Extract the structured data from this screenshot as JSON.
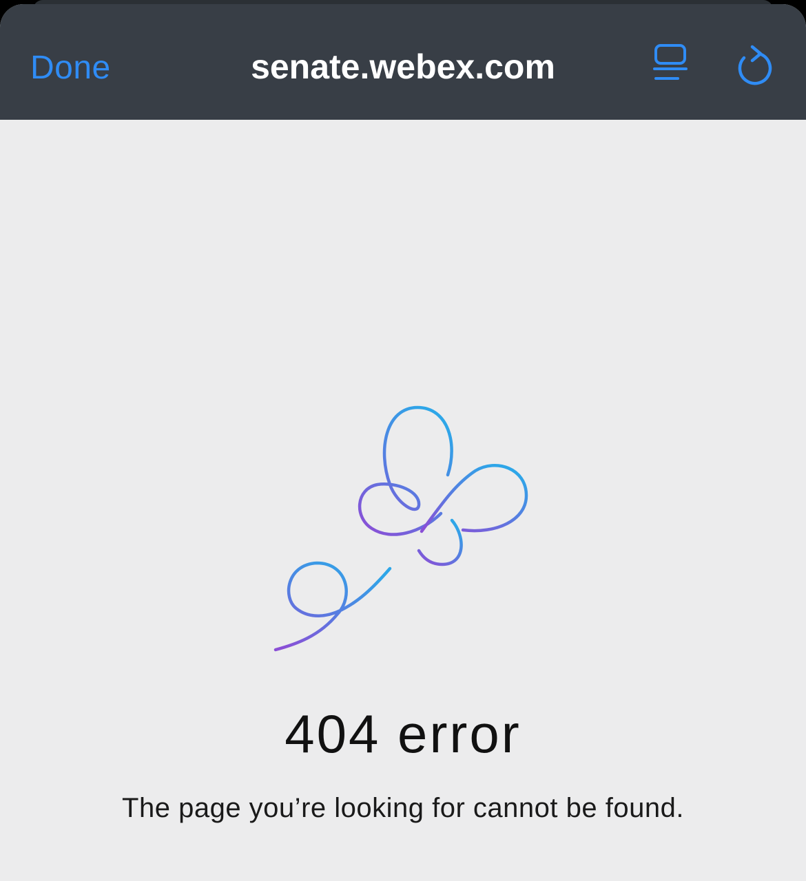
{
  "navbar": {
    "done_label": "Done",
    "url": "senate.webex.com",
    "reader_icon": "reader-view-icon",
    "reload_icon": "reload-icon"
  },
  "error": {
    "title": "404 error",
    "message": "The page you’re looking for cannot be found."
  },
  "colors": {
    "navbar_bg": "#383e46",
    "accent": "#2f8cf5",
    "page_bg": "#ececed",
    "illustration_top": "#2ea6e8",
    "illustration_bottom": "#8a4fd6"
  }
}
